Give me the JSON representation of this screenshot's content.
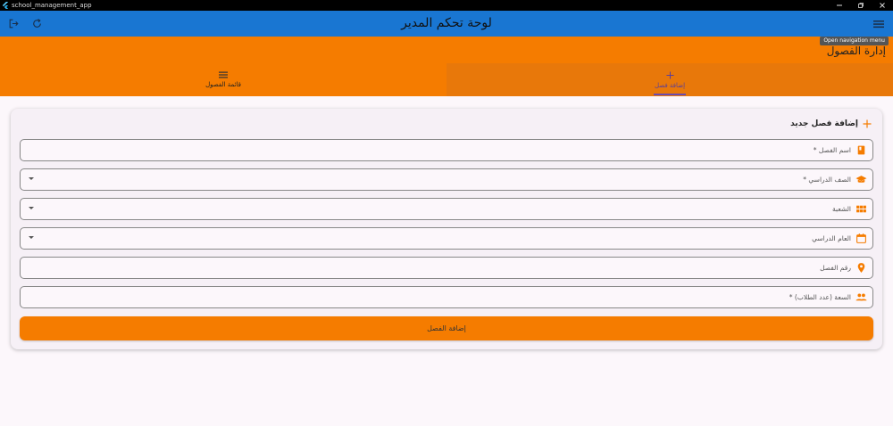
{
  "window": {
    "title": "school_management_app"
  },
  "appbar": {
    "title": "لوحة تحكم المدير",
    "tooltip": "Open navigation menu"
  },
  "section": {
    "title": "إدارة الفصول"
  },
  "tabs": [
    {
      "label": "إضافة فصل",
      "icon": "add-icon",
      "active": true
    },
    {
      "label": "قائمة الفصول",
      "icon": "list-icon",
      "active": false
    }
  ],
  "form": {
    "header": "إضافة فصل جديد",
    "fields": [
      {
        "label": "اسم الفصل *",
        "icon": "book-icon",
        "dropdown": false
      },
      {
        "label": "الصف الدراسي *",
        "icon": "school-icon",
        "dropdown": true
      },
      {
        "label": "الشعبة",
        "icon": "grid-icon",
        "dropdown": true
      },
      {
        "label": "العام الدراسي",
        "icon": "calendar-icon",
        "dropdown": true
      },
      {
        "label": "رقم الفصل",
        "icon": "location-pin-icon",
        "dropdown": false
      },
      {
        "label": "السعة (عدد الطلاب) *",
        "icon": "people-icon",
        "dropdown": false
      }
    ],
    "submit_label": "إضافة الفصل"
  },
  "colors": {
    "appbar": "#1976d2",
    "accent": "#f57c00",
    "tab_indicator": "#6a4bb0",
    "background": "#fcf7fb"
  }
}
